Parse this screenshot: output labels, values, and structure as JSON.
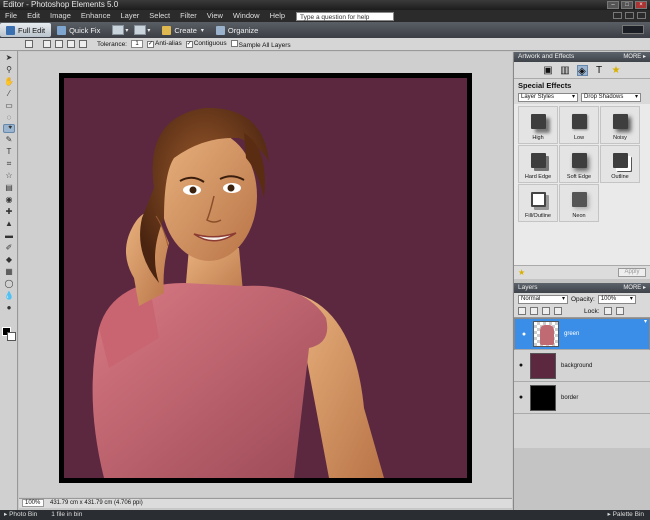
{
  "title": "Editor - Photoshop Elements 5.0",
  "menu": [
    "File",
    "Edit",
    "Image",
    "Enhance",
    "Layer",
    "Select",
    "Filter",
    "View",
    "Window",
    "Help"
  ],
  "help_placeholder": "Type a question for help",
  "tabs": {
    "full_edit": "Full Edit",
    "quick_fix": "Quick Fix"
  },
  "toolbar": {
    "create": "Create",
    "organize": "Organize"
  },
  "options": {
    "tolerance_label": "Tolerance:",
    "tolerance_value": "1",
    "anti_alias": "Anti-alias",
    "contiguous": "Contiguous",
    "sample_all": "Sample All Layers"
  },
  "status": {
    "zoom": "100%",
    "doc_info": "431.79 cm x 431.79 cm (4.706 ppi)"
  },
  "bottom": {
    "photo_bin": "Photo Bin",
    "files_in_bin": "1 file in bin",
    "palette_bin": "Palette Bin"
  },
  "artwork": {
    "header": "Artwork and Effects",
    "more": "MORE ▸",
    "special_effects": "Special Effects",
    "category": "Layer Styles",
    "subcategory": "Drop Shadows",
    "effects": [
      {
        "label": "High",
        "cls": "high"
      },
      {
        "label": "Low",
        "cls": "low"
      },
      {
        "label": "Noisy",
        "cls": "noisy"
      },
      {
        "label": "Hard Edge",
        "cls": "hard"
      },
      {
        "label": "Soft Edge",
        "cls": "soft"
      },
      {
        "label": "Outline",
        "cls": "outline"
      },
      {
        "label": "Fill/Outline",
        "cls": "pill"
      },
      {
        "label": "Neon",
        "cls": "neon"
      }
    ],
    "apply": "Apply"
  },
  "layers": {
    "header": "Layers",
    "more": "MORE ▸",
    "blend_mode": "Normal",
    "opacity_label": "Opacity:",
    "opacity_value": "100%",
    "lock_label": "Lock:",
    "items": [
      {
        "name": "green",
        "selected": true
      },
      {
        "name": "background",
        "selected": false
      },
      {
        "name": "border",
        "selected": false
      }
    ]
  },
  "colors": {
    "canvas_bg": "#5b2840",
    "selection": "#3a8ee8"
  }
}
